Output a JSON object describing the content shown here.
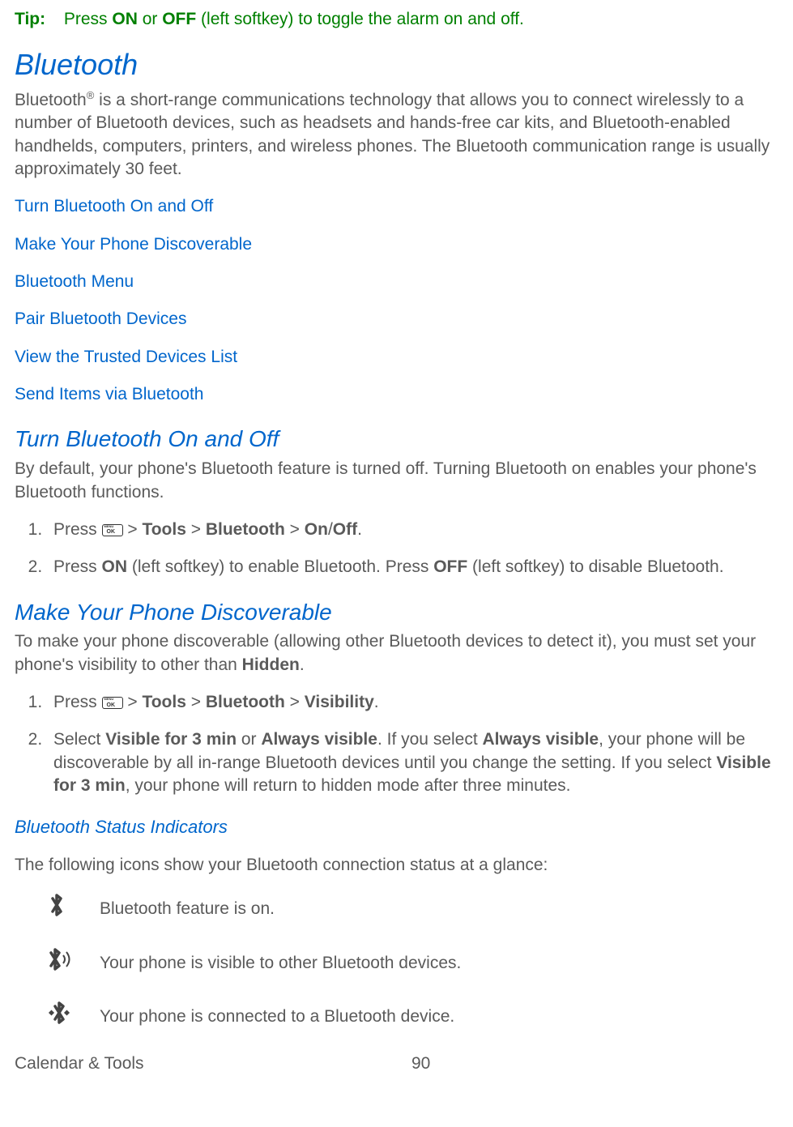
{
  "tip": {
    "label": "Tip:",
    "text_pre": "Press ",
    "on": "ON",
    "text_mid": " or ",
    "off": "OFF",
    "text_post": " (left softkey) to toggle the alarm on and off."
  },
  "h1": "Bluetooth",
  "intro": {
    "word": "Bluetooth",
    "sup": "®",
    "rest": " is a short-range communications technology that allows you to connect wirelessly to a number of Bluetooth devices, such as headsets and hands-free car kits, and Bluetooth-enabled handhelds, computers, printers, and wireless phones. The Bluetooth communication range is usually approximately 30 feet."
  },
  "toc": [
    "Turn Bluetooth On and Off",
    "Make Your Phone Discoverable",
    "Bluetooth Menu",
    "Pair Bluetooth Devices",
    "View the Trusted Devices List",
    "Send Items via Bluetooth"
  ],
  "section1": {
    "title": "Turn Bluetooth On and Off",
    "intro": "By default, your phone's Bluetooth feature is turned off. Turning Bluetooth on enables your phone's Bluetooth functions.",
    "step1": {
      "pre": "Press ",
      "p1": " > ",
      "b1": "Tools",
      "p2": " > ",
      "b2": "Bluetooth",
      "p3": " > ",
      "b3": "On",
      "p4": "/",
      "b4": "Off",
      "post": "."
    },
    "step2": {
      "pre": "Press ",
      "b1": "ON",
      "mid": " (left softkey) to enable Bluetooth. Press ",
      "b2": "OFF",
      "post": " (left softkey) to disable Bluetooth."
    }
  },
  "section2": {
    "title": "Make Your Phone Discoverable",
    "intro_pre": "To make your phone discoverable (allowing other Bluetooth devices to detect it), you must set your phone's visibility to other than ",
    "intro_b": "Hidden",
    "intro_post": ".",
    "step1": {
      "pre": "Press ",
      "p1": " > ",
      "b1": "Tools",
      "p2": " > ",
      "b2": "Bluetooth",
      "p3": " > ",
      "b3": "Visibility",
      "post": "."
    },
    "step2": {
      "pre": "Select ",
      "b1": "Visible for 3 min",
      "t1": " or ",
      "b2": "Always visible",
      "t2": ". If you select ",
      "b3": "Always visible",
      "t3": ", your phone will be discoverable by all in-range Bluetooth devices until you change the setting. If you select ",
      "b4": "Visible for 3 min",
      "t4": ", your phone will return to hidden mode after three minutes."
    }
  },
  "section3": {
    "title": "Bluetooth Status Indicators",
    "intro": "The following icons show your Bluetooth connection status at a glance:",
    "rows": [
      "Bluetooth feature is on.",
      "Your phone is visible to other Bluetooth devices.",
      "Your phone is connected to a Bluetooth device."
    ]
  },
  "footer": {
    "section": "Calendar & Tools",
    "page": "90"
  }
}
